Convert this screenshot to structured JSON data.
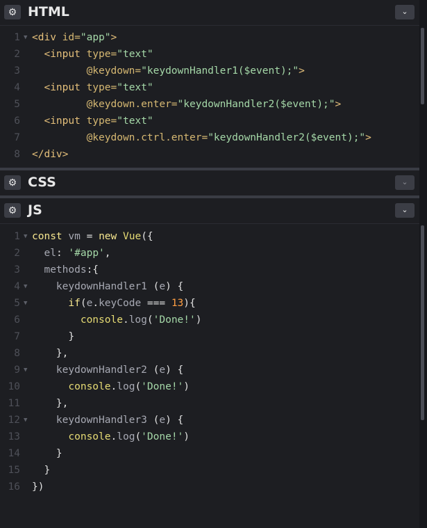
{
  "panels": {
    "html": {
      "title": "HTML",
      "gear": "⚙",
      "chevron": "⌄"
    },
    "css": {
      "title": "CSS",
      "gear": "⚙",
      "chevron": "⌄"
    },
    "js": {
      "title": "JS",
      "gear": "⚙",
      "chevron": "⌄"
    }
  },
  "html_code": [
    {
      "n": "1",
      "fold": true,
      "parts": [
        {
          "t": "<div ",
          "c": "tag"
        },
        {
          "t": "id=",
          "c": "attr"
        },
        {
          "t": "\"app\"",
          "c": "str"
        },
        {
          "t": ">",
          "c": "tag"
        }
      ]
    },
    {
      "n": "2",
      "parts": [
        {
          "t": "  ",
          "c": "plain"
        },
        {
          "t": "<input ",
          "c": "tag"
        },
        {
          "t": "type=",
          "c": "attr"
        },
        {
          "t": "\"text\"",
          "c": "str"
        }
      ]
    },
    {
      "n": "3",
      "parts": [
        {
          "t": "         ",
          "c": "plain"
        },
        {
          "t": "@keydown=",
          "c": "attr"
        },
        {
          "t": "\"keydownHandler1($event);\"",
          "c": "str"
        },
        {
          "t": ">",
          "c": "tag"
        }
      ]
    },
    {
      "n": "4",
      "parts": [
        {
          "t": "  ",
          "c": "plain"
        },
        {
          "t": "<input ",
          "c": "tag"
        },
        {
          "t": "type=",
          "c": "attr"
        },
        {
          "t": "\"text\"",
          "c": "str"
        }
      ]
    },
    {
      "n": "5",
      "parts": [
        {
          "t": "         ",
          "c": "plain"
        },
        {
          "t": "@keydown.enter=",
          "c": "attr"
        },
        {
          "t": "\"keydownHandler2($event);\"",
          "c": "str"
        },
        {
          "t": ">",
          "c": "tag"
        }
      ]
    },
    {
      "n": "6",
      "parts": [
        {
          "t": "  ",
          "c": "plain"
        },
        {
          "t": "<input ",
          "c": "tag"
        },
        {
          "t": "type=",
          "c": "attr"
        },
        {
          "t": "\"text\"",
          "c": "str"
        }
      ]
    },
    {
      "n": "7",
      "parts": [
        {
          "t": "         ",
          "c": "plain"
        },
        {
          "t": "@keydown.ctrl.enter=",
          "c": "attr"
        },
        {
          "t": "\"keydownHandler2($event);\"",
          "c": "str"
        },
        {
          "t": ">",
          "c": "tag"
        }
      ]
    },
    {
      "n": "8",
      "parts": [
        {
          "t": "</div>",
          "c": "tag"
        }
      ]
    }
  ],
  "js_code": [
    {
      "n": "1",
      "fold": true,
      "parts": [
        {
          "t": "const ",
          "c": "kw"
        },
        {
          "t": "vm ",
          "c": "prop"
        },
        {
          "t": "= ",
          "c": "plain"
        },
        {
          "t": "new ",
          "c": "kw"
        },
        {
          "t": "Vue",
          "c": "fn"
        },
        {
          "t": "({",
          "c": "plain"
        }
      ]
    },
    {
      "n": "2",
      "parts": [
        {
          "t": "  ",
          "c": "plain"
        },
        {
          "t": "el",
          "c": "prop"
        },
        {
          "t": ": ",
          "c": "plain"
        },
        {
          "t": "'#app'",
          "c": "str"
        },
        {
          "t": ",",
          "c": "plain"
        }
      ]
    },
    {
      "n": "3",
      "parts": [
        {
          "t": "  ",
          "c": "plain"
        },
        {
          "t": "methods",
          "c": "prop"
        },
        {
          "t": ":{",
          "c": "plain"
        }
      ]
    },
    {
      "n": "4",
      "fold": true,
      "parts": [
        {
          "t": "    ",
          "c": "plain"
        },
        {
          "t": "keydownHandler1 ",
          "c": "prop"
        },
        {
          "t": "(",
          "c": "plain"
        },
        {
          "t": "e",
          "c": "prop"
        },
        {
          "t": ") {",
          "c": "plain"
        }
      ]
    },
    {
      "n": "5",
      "fold": true,
      "parts": [
        {
          "t": "      ",
          "c": "plain"
        },
        {
          "t": "if",
          "c": "kw"
        },
        {
          "t": "(",
          "c": "plain"
        },
        {
          "t": "e",
          "c": "prop"
        },
        {
          "t": ".",
          "c": "plain"
        },
        {
          "t": "keyCode ",
          "c": "prop"
        },
        {
          "t": "=== ",
          "c": "plain"
        },
        {
          "t": "13",
          "c": "num"
        },
        {
          "t": "){",
          "c": "plain"
        }
      ]
    },
    {
      "n": "6",
      "parts": [
        {
          "t": "        ",
          "c": "plain"
        },
        {
          "t": "console",
          "c": "fn"
        },
        {
          "t": ".",
          "c": "plain"
        },
        {
          "t": "log",
          "c": "prop"
        },
        {
          "t": "(",
          "c": "plain"
        },
        {
          "t": "'Done!'",
          "c": "str"
        },
        {
          "t": ")",
          "c": "plain"
        }
      ]
    },
    {
      "n": "7",
      "parts": [
        {
          "t": "      }",
          "c": "plain"
        }
      ]
    },
    {
      "n": "8",
      "parts": [
        {
          "t": "    },",
          "c": "plain"
        }
      ]
    },
    {
      "n": "9",
      "fold": true,
      "parts": [
        {
          "t": "    ",
          "c": "plain"
        },
        {
          "t": "keydownHandler2 ",
          "c": "prop"
        },
        {
          "t": "(",
          "c": "plain"
        },
        {
          "t": "e",
          "c": "prop"
        },
        {
          "t": ") {",
          "c": "plain"
        }
      ]
    },
    {
      "n": "10",
      "parts": [
        {
          "t": "      ",
          "c": "plain"
        },
        {
          "t": "console",
          "c": "fn"
        },
        {
          "t": ".",
          "c": "plain"
        },
        {
          "t": "log",
          "c": "prop"
        },
        {
          "t": "(",
          "c": "plain"
        },
        {
          "t": "'Done!'",
          "c": "str"
        },
        {
          "t": ")",
          "c": "plain"
        }
      ]
    },
    {
      "n": "11",
      "parts": [
        {
          "t": "    },",
          "c": "plain"
        }
      ]
    },
    {
      "n": "12",
      "fold": true,
      "parts": [
        {
          "t": "    ",
          "c": "plain"
        },
        {
          "t": "keydownHandler3 ",
          "c": "prop"
        },
        {
          "t": "(",
          "c": "plain"
        },
        {
          "t": "e",
          "c": "prop"
        },
        {
          "t": ") {",
          "c": "plain"
        }
      ]
    },
    {
      "n": "13",
      "parts": [
        {
          "t": "      ",
          "c": "plain"
        },
        {
          "t": "console",
          "c": "fn"
        },
        {
          "t": ".",
          "c": "plain"
        },
        {
          "t": "log",
          "c": "prop"
        },
        {
          "t": "(",
          "c": "plain"
        },
        {
          "t": "'Done!'",
          "c": "str"
        },
        {
          "t": ")",
          "c": "plain"
        }
      ]
    },
    {
      "n": "14",
      "parts": [
        {
          "t": "    }",
          "c": "plain"
        }
      ]
    },
    {
      "n": "15",
      "parts": [
        {
          "t": "  }",
          "c": "plain"
        }
      ]
    },
    {
      "n": "16",
      "parts": [
        {
          "t": "})",
          "c": "plain"
        }
      ]
    }
  ],
  "fold_glyph": "▼"
}
